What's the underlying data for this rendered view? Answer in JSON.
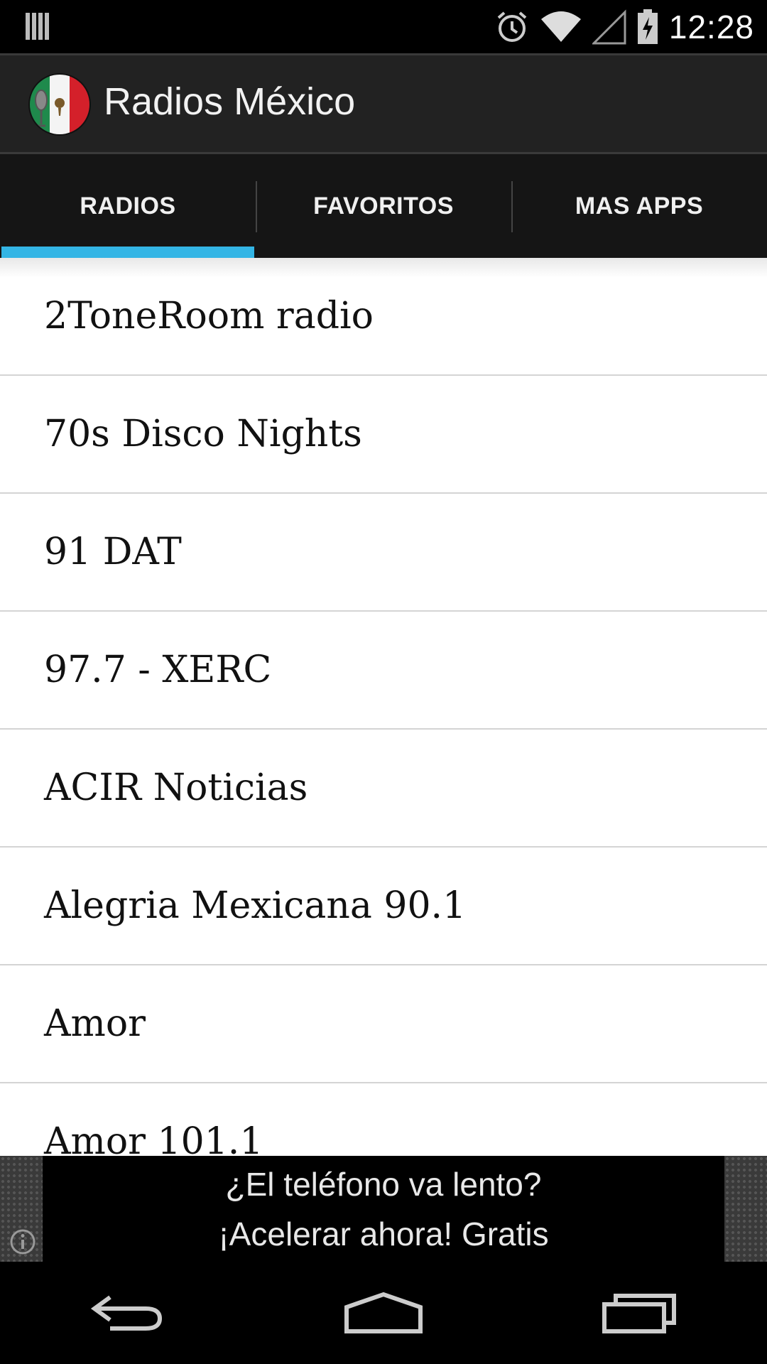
{
  "status_bar": {
    "time": "12:28",
    "icons": [
      "notification-bars-icon",
      "alarm-icon",
      "wifi-icon",
      "signal-icon",
      "battery-charging-icon"
    ]
  },
  "action_bar": {
    "title": "Radios México",
    "logo_icon": "mexico-flag-microphone-icon"
  },
  "tabs": [
    {
      "label": "RADIOS",
      "selected": true
    },
    {
      "label": "FAVORITOS",
      "selected": false
    },
    {
      "label": "MAS APPS",
      "selected": false
    }
  ],
  "accent_color": "#33b5e5",
  "stations": [
    "2ToneRoom radio",
    "70s Disco Nights",
    "91 DAT",
    "97.7 - XERC",
    "ACIR Noticias",
    "Alegria Mexicana 90.1",
    "Amor",
    "Amor 101.1"
  ],
  "ad": {
    "line1": "¿El teléfono va lento?",
    "line2": "¡Acelerar ahora! Gratis"
  },
  "nav_bar": {
    "icons": [
      "back-icon",
      "home-icon",
      "recent-apps-icon"
    ]
  }
}
